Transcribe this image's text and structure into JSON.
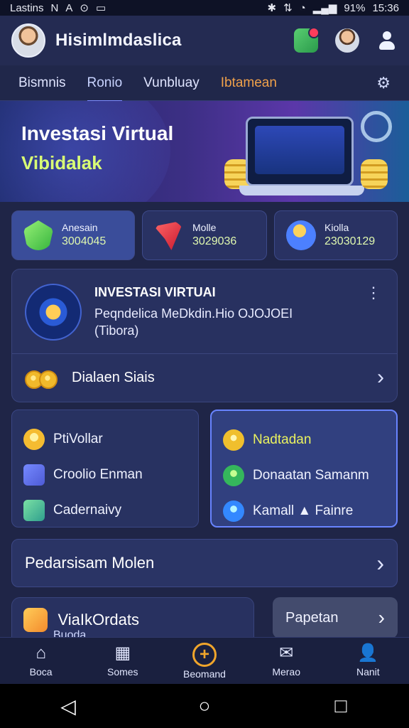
{
  "status_bar": {
    "left_text": "Lastins",
    "left_icons": [
      "N",
      "A",
      "⊙",
      "▭"
    ],
    "right_icons": [
      "✱",
      "⇅",
      "◔",
      "▂▄▆"
    ],
    "battery": "91%",
    "time": "15:36"
  },
  "header": {
    "title": "Hisimlmdaslica"
  },
  "tabs": [
    {
      "label": "Bismnis"
    },
    {
      "label": "Ronio"
    },
    {
      "label": "Vunbluay"
    },
    {
      "label": "Ibtamean"
    }
  ],
  "banner": {
    "title": "Investasi Virtual",
    "subtitle": "Vibidalak"
  },
  "stats": [
    {
      "label": "Anesain",
      "value": "3004045"
    },
    {
      "label": "Molle",
      "value": "3029036"
    },
    {
      "label": "Kiolla",
      "value": "23030129"
    }
  ],
  "invest_card": {
    "title": "INVESTASI VIRTUAI",
    "description_line1": "Peqndelica MeDkdin.Hio OJOJOEI",
    "description_line2": "(Tibora)",
    "footer_label": "Dialaen Siais"
  },
  "features_left": [
    {
      "label": "PtiVollar"
    },
    {
      "label": "Croolio Enman"
    },
    {
      "label": "Cadernaivy"
    }
  ],
  "features_right": [
    {
      "label": "Nadtadan"
    },
    {
      "label": "Donaatan Samanm"
    },
    {
      "label": "Kamall ▲ Fainre"
    }
  ],
  "cta": {
    "label": "Pedarsisam Molen"
  },
  "partial_card": {
    "title": "ViaIkOrdats",
    "subtitle": "Buoda"
  },
  "side_button": {
    "label": "Papetan"
  },
  "bottom_nav": [
    {
      "label": "Boca",
      "icon": "⌂"
    },
    {
      "label": "Somes",
      "icon": "▦"
    },
    {
      "label": "Beomand",
      "icon": "+"
    },
    {
      "label": "Merao",
      "icon": "✉"
    },
    {
      "label": "Nanit",
      "icon": "👤"
    }
  ],
  "colors": {
    "background": "#1f2547",
    "accent_tab": "#f0a14a",
    "highlight_border": "#6884ff"
  }
}
